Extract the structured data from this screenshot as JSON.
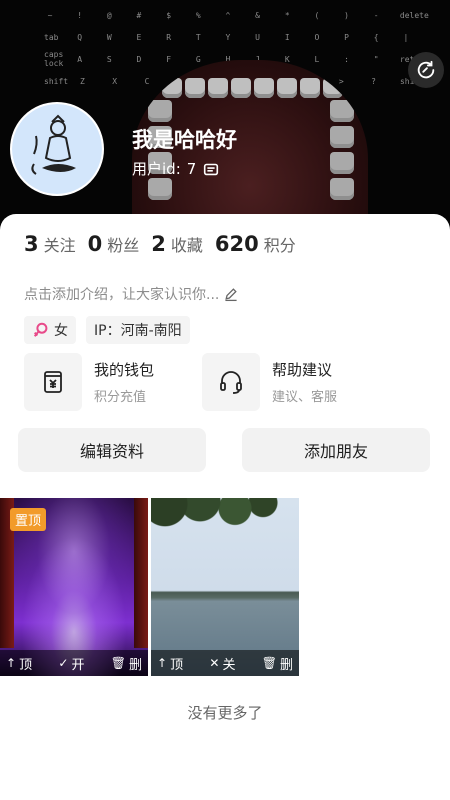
{
  "profile": {
    "username": "我是哈哈好",
    "userid_label": "用户id:",
    "userid_value": "7"
  },
  "stats": [
    {
      "value": "3",
      "label": "关注"
    },
    {
      "value": "0",
      "label": "粉丝"
    },
    {
      "value": "2",
      "label": "收藏"
    },
    {
      "value": "620",
      "label": "积分"
    }
  ],
  "intro": "点击添加介绍，让大家认识你...",
  "tags": {
    "gender": "女",
    "ip": "IP：河南-南阳"
  },
  "services": [
    {
      "title": "我的钱包",
      "subtitle": "积分充值",
      "icon": "wallet-icon"
    },
    {
      "title": "帮助建议",
      "subtitle": "建议、客服",
      "icon": "headset-icon"
    }
  ],
  "actions": {
    "edit_profile": "编辑资料",
    "add_friend": "添加朋友"
  },
  "posts": [
    {
      "badge": "置顶",
      "pin": "顶",
      "toggle": "开",
      "delete": "删"
    },
    {
      "badge": "",
      "pin": "顶",
      "toggle": "关",
      "delete": "删"
    }
  ],
  "footer": {
    "no_more": "没有更多了"
  },
  "cover_keys": {
    "row1": [
      "~",
      "!",
      "@",
      "#",
      "$",
      "%",
      "^",
      "&",
      "*",
      "(",
      ")",
      "-",
      "delete"
    ],
    "row2": [
      "tab",
      "Q",
      "W",
      "E",
      "R",
      "T",
      "Y",
      "U",
      "I",
      "O",
      "P",
      "{",
      "|"
    ],
    "row3": [
      "caps lock",
      "A",
      "S",
      "D",
      "F",
      "G",
      "H",
      "J",
      "K",
      "L",
      ":",
      "\"",
      "return"
    ],
    "row4": [
      "shift",
      "Z",
      "X",
      "C",
      "V",
      "B",
      "N",
      "M",
      "<",
      ">",
      "?",
      "shift"
    ]
  },
  "colors": {
    "pin_badge": "#f29b2a",
    "avatar_bg": "#d3e6fb",
    "gender_pink": "#e84a8a"
  }
}
